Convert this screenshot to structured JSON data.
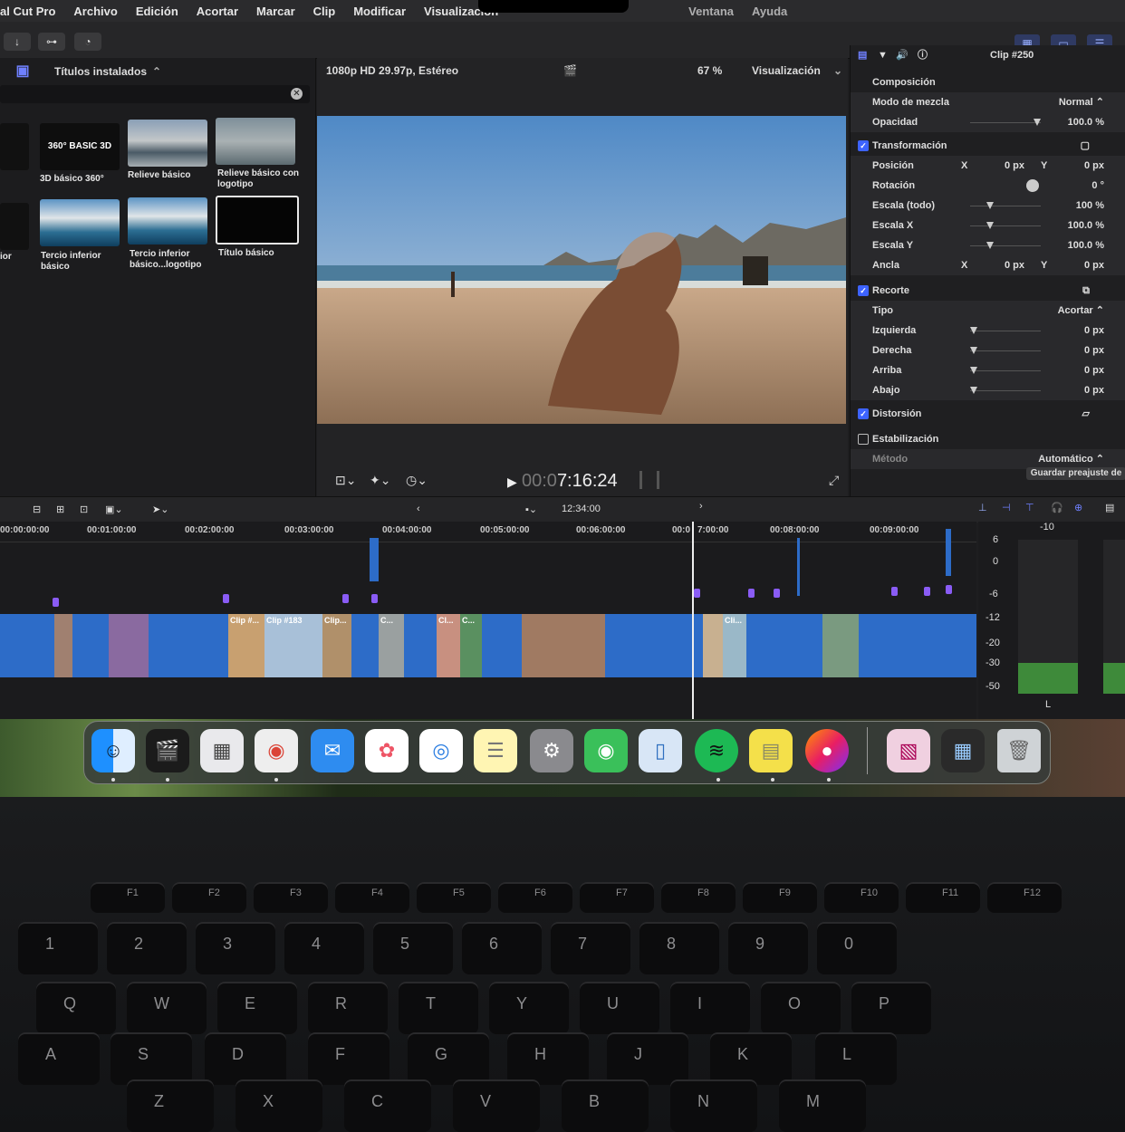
{
  "menu": {
    "app": "al Cut Pro",
    "items": [
      "Archivo",
      "Edición",
      "Acortar",
      "Marcar",
      "Clip",
      "Modificar",
      "Visualización",
      "Ventana",
      "Ayuda"
    ]
  },
  "browser": {
    "title": "Títulos instalados",
    "items": [
      {
        "label": "3D básico 360°",
        "thumb_text": "360° BASIC 3D"
      },
      {
        "label": "Relieve básico"
      },
      {
        "label": "Relieve básico con logotipo"
      },
      {
        "label": "ior"
      },
      {
        "label": "Tercio inferior básico"
      },
      {
        "label": "Tercio inferior básico...logotipo"
      },
      {
        "label": "Título básico"
      }
    ]
  },
  "viewer": {
    "format": "1080p HD 29.97p, Estéreo",
    "zoom": "67 %",
    "view_label": "Visualización",
    "timecode": "00:07:16:24",
    "timecode_dim": "00:0",
    "timecode_bright": "7:16:24"
  },
  "inspector": {
    "clip": "Clip #250",
    "composicion": "Composición",
    "modo_label": "Modo de mezcla",
    "modo_value": "Normal ⌃",
    "opacidad_label": "Opacidad",
    "opacidad_value": "100.0 %",
    "transform": "Transformación",
    "posicion": "Posición",
    "x": "X",
    "y": "Y",
    "zero_px": "0 px",
    "rotacion": "Rotación",
    "rot_value": "0 °",
    "escala_todo": "Escala (todo)",
    "escala_todo_value": "100 %",
    "escala_x": "Escala X",
    "escala_x_value": "100.0 %",
    "escala_y": "Escala Y",
    "escala_y_value": "100.0 %",
    "ancla": "Ancla",
    "recorte": "Recorte",
    "tipo": "Tipo",
    "tipo_value": "Acortar ⌃",
    "izquierda": "Izquierda",
    "derecha": "Derecha",
    "arriba": "Arriba",
    "abajo": "Abajo",
    "distorsion": "Distorsión",
    "estabilizacion": "Estabilización",
    "metodo": "Método",
    "metodo_value": "Automático ⌃",
    "preset_button": "Guardar preajuste de"
  },
  "timeline": {
    "duration": "12:34:00",
    "ruler": [
      "00:00:00:00",
      "00:01:00:00",
      "00:02:00:00",
      "00:03:00:00",
      "00:04:00:00",
      "00:05:00:00",
      "00:06:00:00",
      "00:0",
      "7:00:00",
      "00:08:00:00",
      "00:09:00:00"
    ],
    "clip_labels": [
      "Clip #...",
      "Clip #183",
      "Clip...",
      "C...",
      "Cl...",
      "C...",
      "Cli..."
    ]
  },
  "meters": {
    "scale": [
      "-10",
      "6",
      "0",
      "-6",
      "-12",
      "-20",
      "-30",
      "-50"
    ],
    "channel": "L"
  },
  "keyboard": {
    "fn": [
      "F1",
      "F2",
      "F3",
      "F4",
      "F5",
      "F6",
      "F7",
      "F8",
      "F9",
      "F10",
      "F11",
      "F12"
    ],
    "numbers": [
      "1",
      "2",
      "3",
      "4",
      "5",
      "6",
      "7",
      "8",
      "9",
      "0"
    ],
    "qwerty": [
      "Q",
      "W",
      "E",
      "R",
      "T",
      "Y",
      "U",
      "I",
      "O",
      "P"
    ],
    "asdf": [
      "A",
      "S",
      "D",
      "F",
      "G",
      "H",
      "J",
      "K",
      "L"
    ],
    "zxcv": [
      "Z",
      "X",
      "C",
      "V",
      "B",
      "N",
      "M"
    ]
  },
  "dock_icons": [
    "finder-icon",
    "final-cut-icon",
    "launchpad-icon",
    "chrome-icon",
    "mail-icon",
    "photos-icon",
    "safari-icon",
    "notes-icon",
    "system-settings-icon",
    "find-my-icon",
    "preview-icon",
    "spotify-icon",
    "stickies-icon",
    "firefox-icon",
    "document-icon",
    "folder-icon",
    "trash-icon"
  ],
  "colors": {
    "accent": "#3d63ff",
    "clip": "#2d6cc8",
    "marker": "#8a5cf5"
  }
}
